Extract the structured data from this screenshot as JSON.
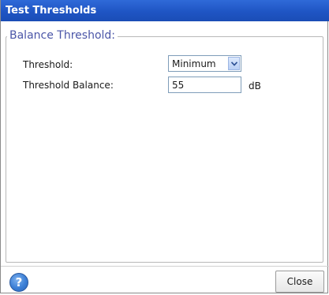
{
  "window": {
    "title": "Test Thresholds"
  },
  "group": {
    "legend": "Balance Threshold:"
  },
  "fields": {
    "threshold": {
      "label": "Threshold:",
      "selected": "Minimum"
    },
    "threshold_balance": {
      "label": "Threshold Balance:",
      "value": "55",
      "unit": "dB"
    }
  },
  "footer": {
    "help_icon": "question-mark-icon",
    "help_glyph": "?",
    "close_label": "Close"
  },
  "colors": {
    "titlebar": "#1f55c4",
    "legend": "#4b56a8",
    "help": "#3b7fd6"
  }
}
